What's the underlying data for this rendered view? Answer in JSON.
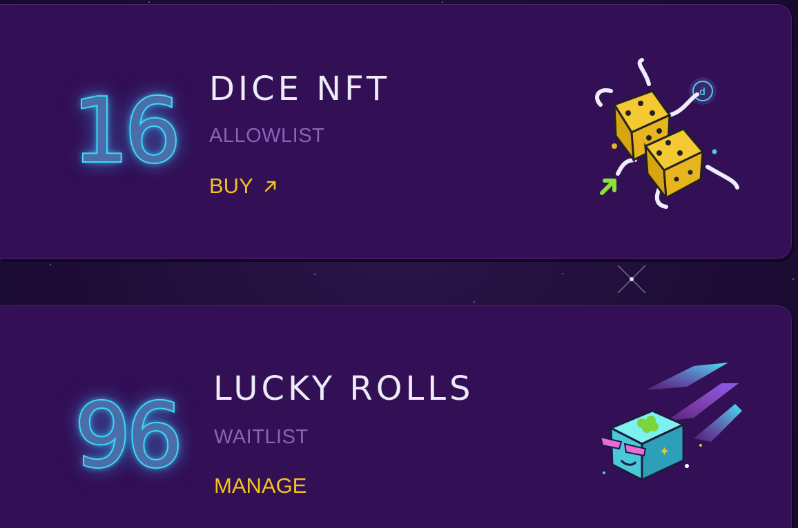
{
  "cards": [
    {
      "count": "16",
      "title": "DICE NFT",
      "status": "ALLOWLIST",
      "action_label": "BUY",
      "action_icon": "arrow-up-right-icon",
      "art_icon": "dice-characters-icon"
    },
    {
      "count": "96",
      "title": "LUCKY ROLLS",
      "status": "WAITLIST",
      "action_label": "MANAGE",
      "art_icon": "lucky-box-icon"
    }
  ],
  "colors": {
    "card_background": "#330f55",
    "page_background": "#1f0f3a",
    "count_glow": "#3fe6f5",
    "title": "#ecebf7",
    "status": "#8a63b8",
    "action": "#f2c31d"
  }
}
